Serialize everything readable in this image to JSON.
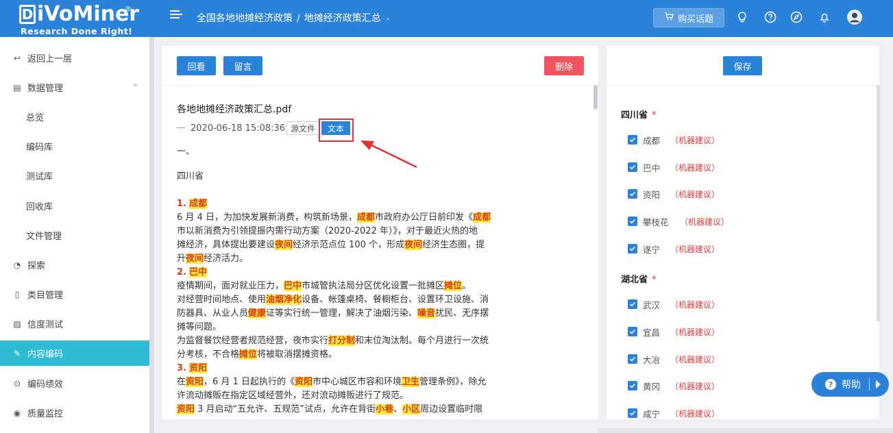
{
  "header": {
    "logo_text": "iVoMiner",
    "logo_letter": "D",
    "logo_reg": "®",
    "logo_tagline": "Research Done Right!",
    "breadcrumb": [
      "全国各地地摊经济政策",
      "地摊经济政策汇总"
    ],
    "breadcrumb_sep": "/",
    "buy_label": "购买话题",
    "icons": [
      "menu-toggle-icon",
      "cart-icon",
      "lightbulb-icon",
      "help-circle-icon",
      "compass-icon",
      "bell-icon",
      "user-avatar-icon"
    ]
  },
  "sidebar": {
    "items": [
      {
        "label": "返回上一层",
        "icon": "↩"
      },
      {
        "label": "数据管理",
        "icon": "▤",
        "caret": "^"
      },
      {
        "label": "总览"
      },
      {
        "label": "编码库"
      },
      {
        "label": "测试库"
      },
      {
        "label": "回收库"
      },
      {
        "label": "文件管理"
      },
      {
        "label": "探索",
        "icon": "◔"
      },
      {
        "label": "类目管理",
        "icon": "▯"
      },
      {
        "label": "信度测试",
        "icon": "▨"
      },
      {
        "label": "内容编码",
        "icon": "✎"
      },
      {
        "label": "编码绩效",
        "icon": "⊙"
      },
      {
        "label": "质量监控",
        "icon": "◉"
      }
    ]
  },
  "toolbar": {
    "review_label": "回看",
    "comment_label": "留言",
    "delete_label": "删除"
  },
  "document": {
    "title": "各地地摊经济政策汇总.pdf",
    "datetime": "2020-06-18 15:08:36",
    "source_tag": "源文件",
    "text_tag": "文本"
  },
  "doc_lines": {
    "l0": "一、",
    "l1": "四川省",
    "s1_num": "1.",
    "s1_name": "成都",
    "l3a": "6 月 4 日，为加快发展新消费，构筑新场景，",
    "l3b": "成都",
    "l3c": "市政府办公厅日前印发《",
    "l3d": "成都",
    "l4": "市以新消费为引领提振内需行动方案（2020-2022 年）》，对于最近火热的地",
    "l5a": "摊经济，具体提出要建设",
    "l5b": "夜间",
    "l5c": "经济示范点位 100 个，形成",
    "l5d": "夜间",
    "l5e": "经济生态圈，提",
    "l6a": "升",
    "l6b": "夜间",
    "l6c": "经济活力。",
    "s2_num": "2.",
    "s2_name": "巴中",
    "l8a": "疫情期间，面对就业压力，",
    "l8b": "巴中",
    "l8c": "市城管执法局分区优化设置一批摊区",
    "l8d": "摊位",
    "l8e": "。",
    "l9a": "对经营时间地点、使用",
    "l9b": "油烟净化",
    "l9c": "设备、帐篷桌椅、餐橱柜台、设置环卫设施、消",
    "l10a": "防器具、从业人员",
    "l10b": "健康",
    "l10c": "证等实行统一管理，解决了油烟污染、",
    "l10d": "噪音",
    "l10e": "扰民、无序摆",
    "l11": "摊等问题。",
    "l12a": "为监督餐饮经营者规范经营，夜市实行",
    "l12b": "打分制",
    "l12c": "和末位淘汰制。每个月进行一次统",
    "l13a": "分考核，不合格",
    "l13b": "摊位",
    "l13c": "将被取消摆摊资格。",
    "s3_num": "3.",
    "s3_name": "资阳",
    "l15a": "在",
    "l15b": "资阳",
    "l15c": "，6 月 1 日起执行的《",
    "l15d": "资阳",
    "l15e": "市中心城区市容和环境",
    "l15f": "卫生",
    "l15g": "管理条例》，除允",
    "l16": "许流动摊贩在指定区域经营外，还对流动摊贩进行了规范。",
    "l17a": "资阳",
    "l17b": " 3 月启动“五允许、五规范”试点，允许在背街",
    "l17c": "小巷",
    "l17d": "、",
    "l17e": "小区",
    "l17f": "周边设置临时限"
  },
  "right_panel": {
    "save_label": "保存",
    "groups": [
      {
        "name": "四川省",
        "required": "*",
        "items": [
          "成都",
          "巴中",
          "资阳",
          "攀枝花",
          "遂宁"
        ]
      },
      {
        "name": "湖北省",
        "required": "*",
        "items": [
          "武汉",
          "宜昌",
          "大冶",
          "黄冈",
          "咸宁"
        ]
      }
    ],
    "suggestion_label": "（机器建议）"
  },
  "help": {
    "label": "帮助",
    "q": "?"
  }
}
